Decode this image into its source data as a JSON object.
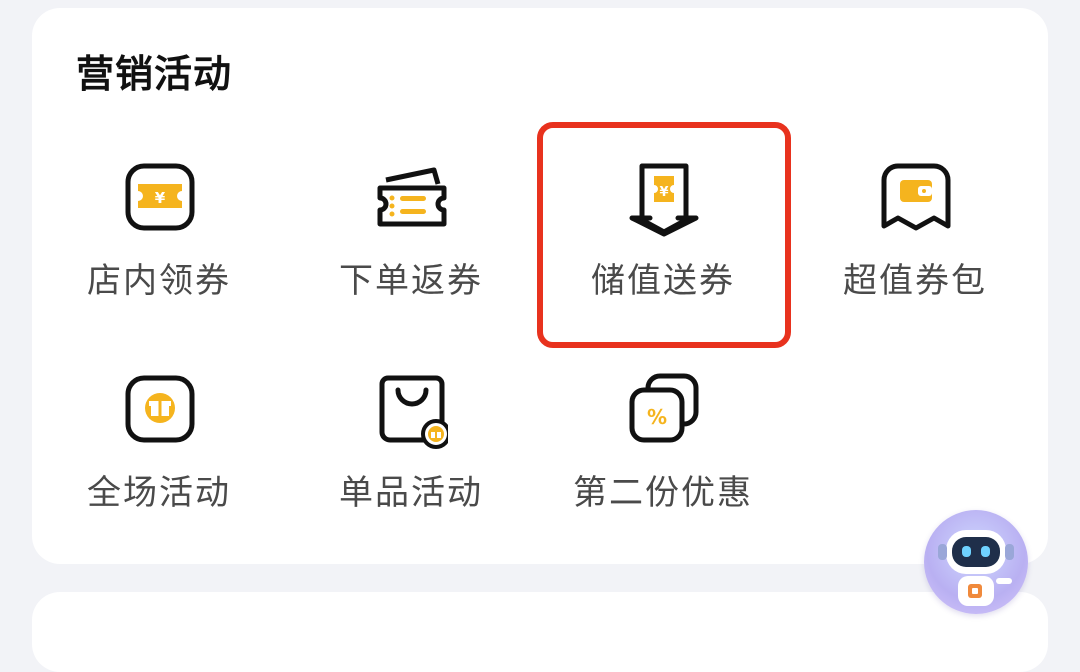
{
  "section": {
    "title": "营销活动"
  },
  "items": [
    {
      "label": "店内领券",
      "icon": "shop-coupon-icon"
    },
    {
      "label": "下单返券",
      "icon": "order-rebate-coupon-icon"
    },
    {
      "label": "储值送券",
      "icon": "stored-value-coupon-icon"
    },
    {
      "label": "超值券包",
      "icon": "coupon-pack-icon"
    },
    {
      "label": "全场活动",
      "icon": "store-wide-gift-icon"
    },
    {
      "label": "单品活动",
      "icon": "single-item-bag-icon"
    },
    {
      "label": "第二份优惠",
      "icon": "second-item-discount-icon"
    }
  ],
  "highlighted_item": "储值送券",
  "colors": {
    "accent": "#f5b41e",
    "highlight_border": "#e8321e",
    "icon_stroke": "#111111",
    "label_text": "#4a4a4a"
  },
  "assistant": {
    "icon": "robot-assistant-icon"
  }
}
